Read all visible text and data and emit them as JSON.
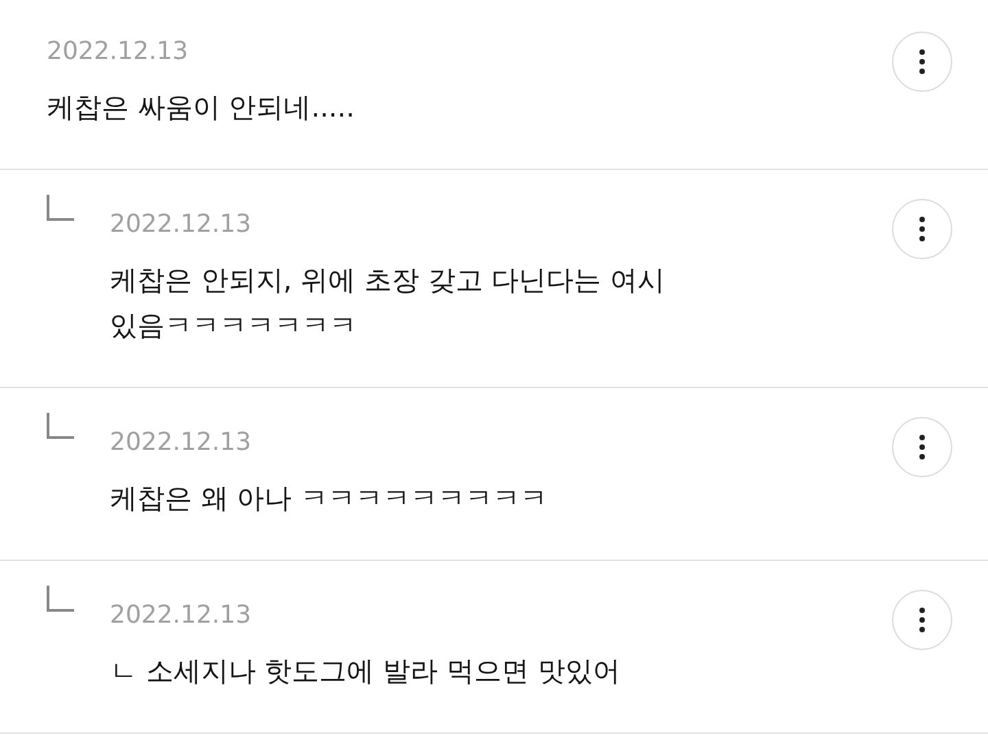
{
  "comments": [
    {
      "kind": "comment",
      "date": "2022.12.13",
      "text": "케찹은 싸움이 안되네....."
    },
    {
      "kind": "reply",
      "date": "2022.12.13",
      "text": "케찹은 안되지, 위에 초장 갖고 다닌다는 여시 있음ㅋㅋㅋㅋㅋㅋㅋ"
    },
    {
      "kind": "reply",
      "date": "2022.12.13",
      "text": "케찹은 왜 아나 ㅋㅋㅋㅋㅋㅋㅋㅋㅋ"
    },
    {
      "kind": "reply",
      "date": "2022.12.13",
      "text": "ㄴ 소세지나 핫도그에 발라 먹으면 맛있어"
    }
  ]
}
